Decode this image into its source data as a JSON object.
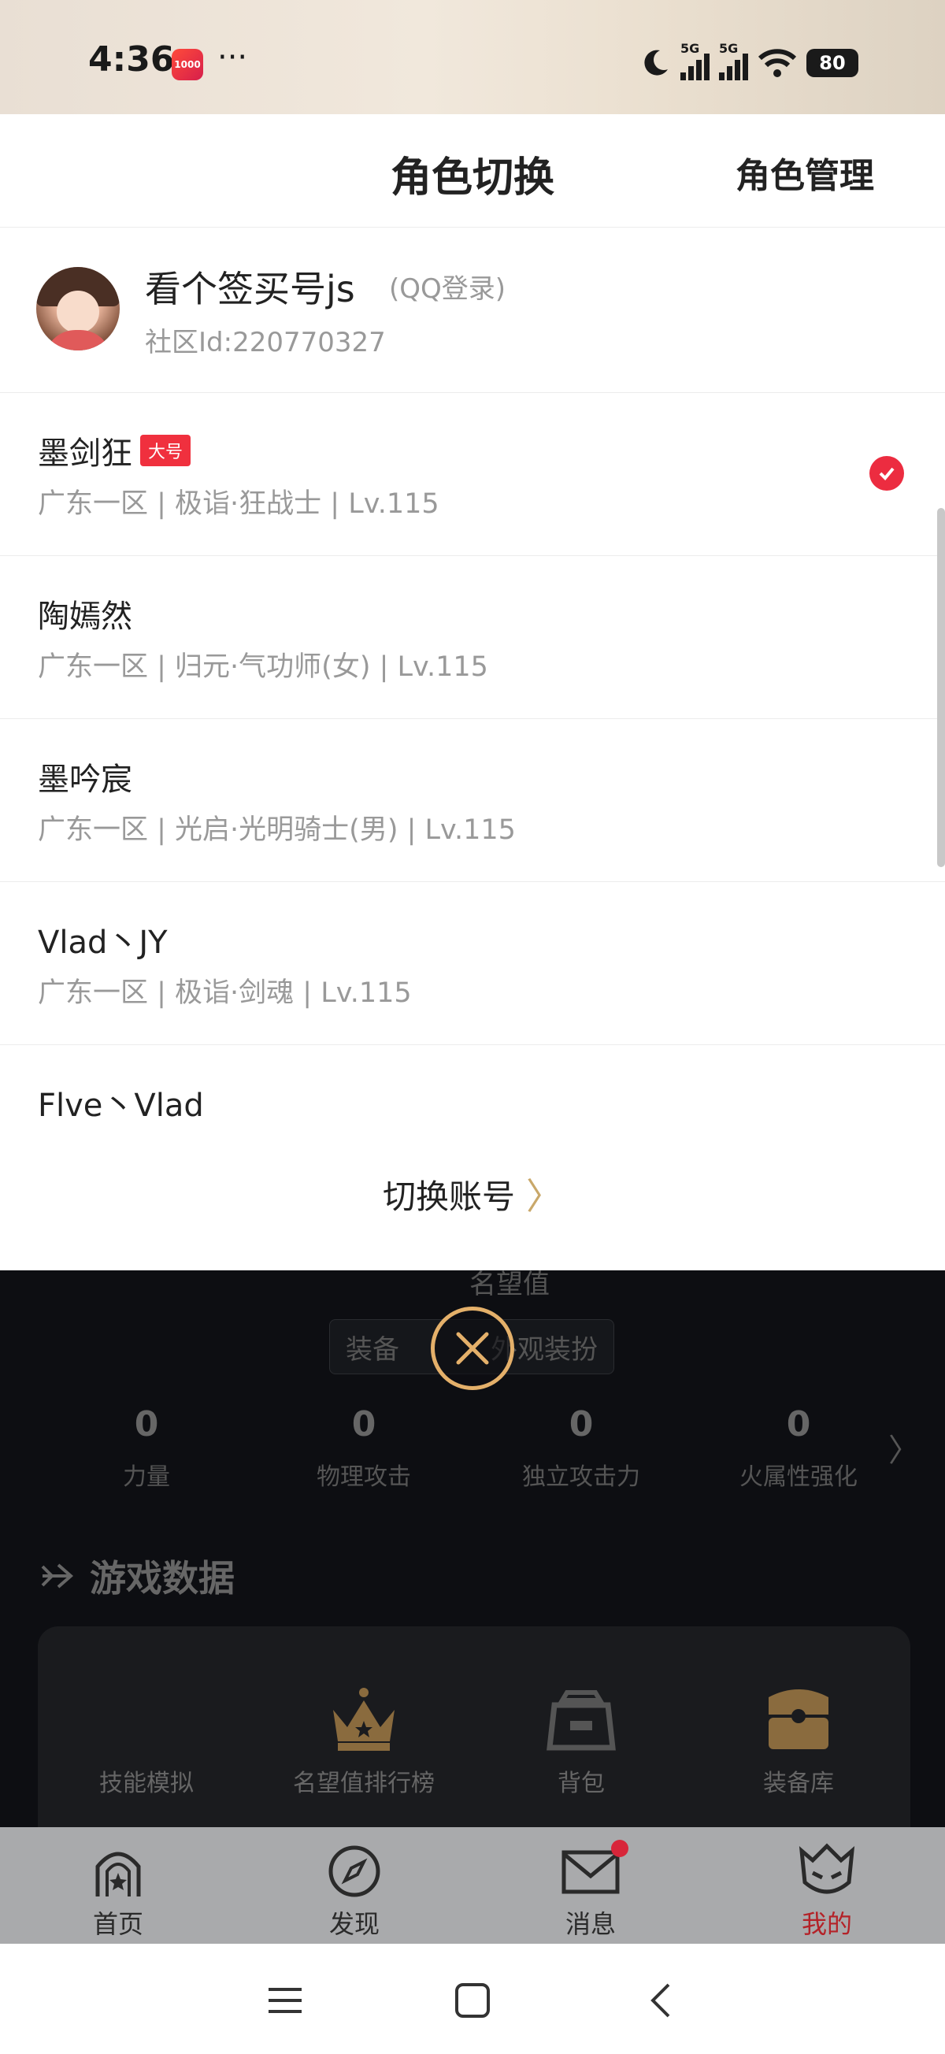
{
  "status_bar": {
    "time": "4:36",
    "app_icon_text": "1000",
    "dots": "···",
    "signal1_label": "5G",
    "signal2_label": "5G",
    "battery": "80"
  },
  "sheet": {
    "title": "角色切换",
    "manage_label": "角色管理",
    "account": {
      "name": "看个签买号js",
      "login_type": "(QQ登录)",
      "community_id": "社区Id:220770327"
    },
    "roles": [
      {
        "name": "墨剑狂",
        "badge": "大号",
        "detail": "广东一区 | 极诣·狂战士 | Lv.115",
        "selected": true
      },
      {
        "name": "陶嫣然",
        "badge": "",
        "detail": "广东一区 | 归元·气功师(女) | Lv.115",
        "selected": false
      },
      {
        "name": "墨吟宸",
        "badge": "",
        "detail": "广东一区 | 光启·光明骑士(男) | Lv.115",
        "selected": false
      },
      {
        "name": "Vlad丶JY",
        "badge": "",
        "detail": "广东一区 | 极诣·剑魂 | Lv.115",
        "selected": false
      },
      {
        "name": "Flve丶Vlad",
        "badge": "",
        "detail": "",
        "selected": false
      }
    ],
    "switch_account_label": "切换账号",
    "switch_account_chevron": "〉"
  },
  "background": {
    "fame_label": "名望值",
    "tabs": [
      "装备",
      "外观装扮"
    ],
    "stats": [
      {
        "value": "0",
        "label": "力量"
      },
      {
        "value": "0",
        "label": "物理攻击"
      },
      {
        "value": "0",
        "label": "独立攻击力"
      },
      {
        "value": "0",
        "label": "火属性强化"
      }
    ],
    "stats_arrow": "〉",
    "section_title": "游戏数据",
    "tools": [
      {
        "label": "技能模拟",
        "icon": "skill-icon"
      },
      {
        "label": "名望值排行榜",
        "icon": "crown-icon"
      },
      {
        "label": "背包",
        "icon": "backpack-icon"
      },
      {
        "label": "装备库",
        "icon": "chest-icon"
      }
    ]
  },
  "bottom_nav": [
    {
      "label": "首页",
      "icon": "home-arch-icon"
    },
    {
      "label": "发现",
      "icon": "compass-icon"
    },
    {
      "label": "消息",
      "icon": "mail-icon",
      "has_dot": true
    },
    {
      "label": "我的",
      "icon": "helmet-icon",
      "active": true
    }
  ],
  "colors": {
    "accent_red": "#ec2c40",
    "gold": "#e4b06a",
    "active_tab": "#b42228"
  }
}
